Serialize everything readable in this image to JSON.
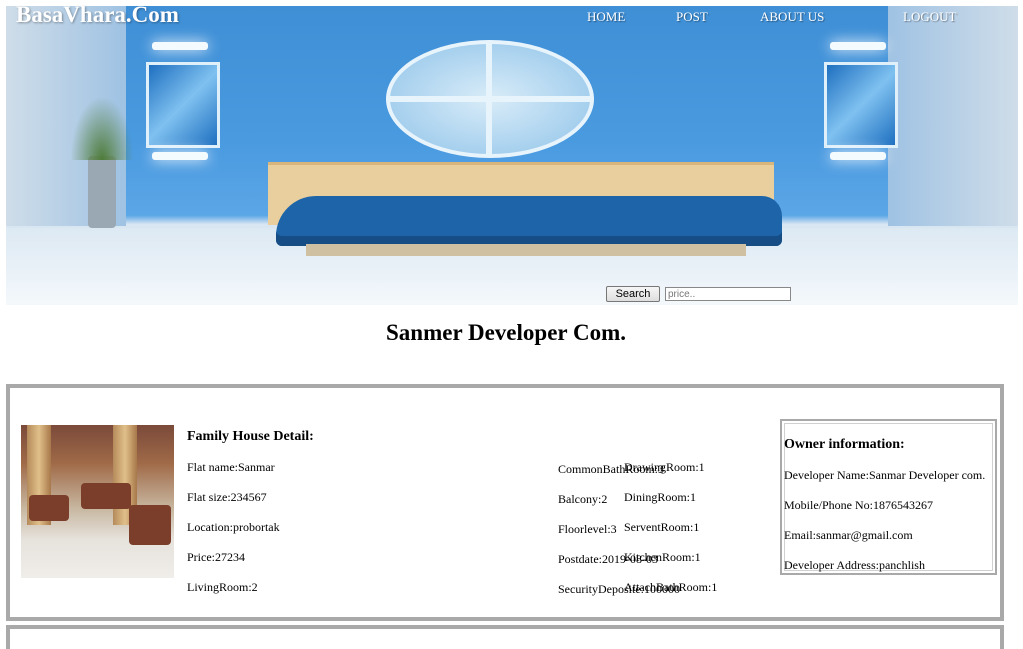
{
  "header": {
    "logo": "BasaVhara.Com",
    "nav": [
      "HOME",
      "POST",
      "ABOUT US",
      "LOGOUT"
    ],
    "search": {
      "button_label": "Search",
      "placeholder": "price.."
    }
  },
  "page_title": "Sanmer Developer Com.",
  "listing": {
    "detail_heading": "Family House Detail:",
    "left_fields": [
      "Flat name:Sanmar",
      "Flat size:234567",
      "Location:probortak",
      "Price:27234",
      "LivingRoom:2"
    ],
    "middle_fields": [
      "CommonBathRoom:3",
      "Balcony:2",
      "Floorlevel:3",
      "Postdate:2019-08-03",
      "SecurityDeposite:100000"
    ],
    "right_fields": [
      "DrawingRoom:1",
      "DiningRoom:1",
      "ServentRoom:1",
      "KitchenRoom:1",
      "AttachBathRoom:1"
    ],
    "owner": {
      "heading": "Owner information:",
      "fields": [
        "Developer Name:Sanmar Developer com.",
        "Mobile/Phone No:1876543267",
        "Email:sanmar@gmail.com",
        "Developer Address:panchlish"
      ]
    }
  },
  "colors": {
    "nav_text": "#ffffff",
    "card_border": "#a9a9a9"
  }
}
